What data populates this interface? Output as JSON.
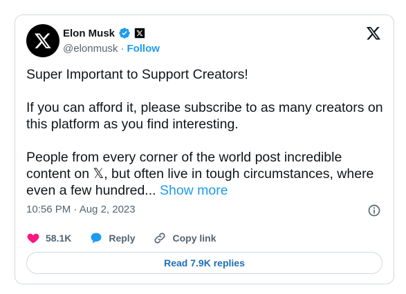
{
  "author": {
    "name": "Elon Musk",
    "handle": "@elonmusk",
    "separator": "·",
    "follow_label": "Follow",
    "verified_icon": "verified-badge-icon",
    "affiliate_icon": "x-affiliate-badge-icon",
    "avatar_icon": "x-logo-icon"
  },
  "tweet": {
    "text": "Super Important to Support Creators!\n\nIf you can afford it, please subscribe to as many creators on this platform as you find interesting.\n\nPeople from every corner of the world post incredible content on 𝕏, but often live in tough circumstances, where even a few hundred... ",
    "show_more_label": "Show more",
    "timestamp": "10:56 PM · Aug 2, 2023"
  },
  "actions": {
    "like_count": "58.1K",
    "reply_label": "Reply",
    "copy_link_label": "Copy link",
    "like_color": "#f91880",
    "reply_color": "#1d9bf0"
  },
  "replies_button_label": "Read 7.9K replies",
  "colors": {
    "accent": "#1d9bf0",
    "muted": "#536471",
    "border": "#cfd9de"
  }
}
